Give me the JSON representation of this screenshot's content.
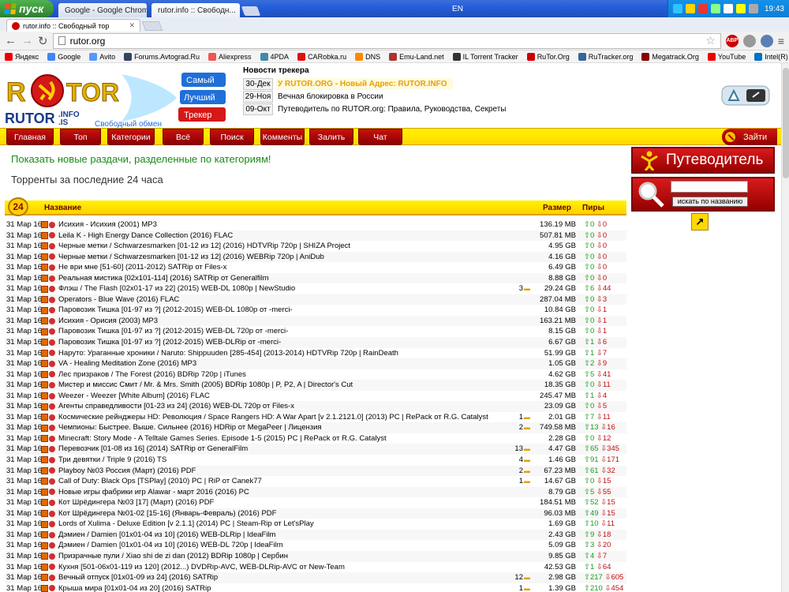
{
  "taskbar": {
    "start": "пуск",
    "tabs": [
      {
        "title": "Google - Google Chrome"
      },
      {
        "title": "rutor.info :: Свободн..."
      }
    ],
    "lang": "EN",
    "time": "19:43"
  },
  "browser": {
    "tab_title": "rutor.info :: Свободный тор",
    "url": "rutor.org",
    "bookmarks": [
      "Яндекс",
      "Google",
      "Avito",
      "Forums.Avtograd.Ru",
      "Aliexpress",
      "4PDA",
      "CARobka.ru",
      "DNS",
      "Emu-Land.net",
      "IL Torrent Tracker",
      "RuTor.Org",
      "RuTracker.org",
      "Megatrack.Org",
      "YouTube",
      "Intel(R) Retail Edge"
    ]
  },
  "site": {
    "logo_words": [
      "Самый",
      "Лучший",
      "Трекер"
    ],
    "logo_sub": "Свободный обмен",
    "news_title": "Новости трекера",
    "news": [
      {
        "date": "30-Дек",
        "text": "У RUTOR.ORG - Новый Адрес: RUTOR.INFO"
      },
      {
        "date": "29-Ноя",
        "text": "Вечная блокировка в России"
      },
      {
        "date": "09-Окт",
        "text": "Путеводитель по RUTOR.org: Правила, Руководства, Секреты"
      }
    ],
    "menu": [
      "Главная",
      "Топ",
      "Категории",
      "Всё",
      "Поиск",
      "Комменты",
      "Залить",
      "Чат"
    ],
    "enter": "Зайти",
    "show_categories": "Показать новые раздачи, разделенные по категориям!",
    "last24": "Торренты за последние 24 часа",
    "badge": "24",
    "col_name": "Название",
    "col_size": "Размер",
    "col_peers": "Пиры",
    "guide": "Путеводитель",
    "search_button": "искать по названию"
  },
  "rows": [
    {
      "date": "31 Мар 16",
      "name": "Исихия - Исихия (2001) MP3",
      "com": "",
      "size": "136.19 MB",
      "up": "0",
      "dn": "0"
    },
    {
      "date": "31 Мар 16",
      "name": "Leila K - High Energy Dance Collection (2016) FLAC",
      "com": "",
      "size": "507.81 MB",
      "up": "0",
      "dn": "0"
    },
    {
      "date": "31 Мар 16",
      "name": "Черные метки / Schwarzesmarken [01-12 из 12] (2016) HDTVRip 720p | SHIZA Project",
      "com": "",
      "size": "4.95 GB",
      "up": "0",
      "dn": "0"
    },
    {
      "date": "31 Мар 16",
      "name": "Черные метки / Schwarzesmarken [01-12 из 12] (2016) WEBRip 720p | AniDub",
      "com": "",
      "size": "4.16 GB",
      "up": "0",
      "dn": "0"
    },
    {
      "date": "31 Мар 16",
      "name": "Не ври мне [51-60] (2011-2012) SATRip от Files-x",
      "com": "",
      "size": "6.49 GB",
      "up": "0",
      "dn": "0"
    },
    {
      "date": "31 Мар 16",
      "name": "Реальная мистика [02x101-114] (2016) SATRip от Generalfilm",
      "com": "",
      "size": "8.88 GB",
      "up": "0",
      "dn": "0"
    },
    {
      "date": "31 Мар 16",
      "name": "Флэш / The Flash [02x01-17 из 22] (2015) WEB-DL 1080p | NewStudio",
      "com": "3",
      "size": "29.24 GB",
      "up": "6",
      "dn": "44"
    },
    {
      "date": "31 Мар 16",
      "name": "Operators - Blue Wave (2016) FLAC",
      "com": "",
      "size": "287.04 MB",
      "up": "0",
      "dn": "3"
    },
    {
      "date": "31 Мар 16",
      "name": "Паровозик Тишка [01-97 из ?] (2012-2015) WEB-DL 1080p от -merci-",
      "com": "",
      "size": "10.84 GB",
      "up": "0",
      "dn": "1"
    },
    {
      "date": "31 Мар 16",
      "name": "Исихия - Орисия (2003) MP3",
      "com": "",
      "size": "163.21 MB",
      "up": "0",
      "dn": "1"
    },
    {
      "date": "31 Мар 16",
      "name": "Паровозик Тишка [01-97 из ?] (2012-2015) WEB-DL 720p от -merci-",
      "com": "",
      "size": "8.15 GB",
      "up": "0",
      "dn": "1"
    },
    {
      "date": "31 Мар 16",
      "name": "Паровозик Тишка [01-97 из ?] (2012-2015) WEB-DLRip от -merci-",
      "com": "",
      "size": "6.67 GB",
      "up": "1",
      "dn": "6"
    },
    {
      "date": "31 Мар 16",
      "name": "Наруто: Ураганные хроники / Naruto: Shippuuden [285-454] (2013-2014) HDTVRip 720p | RainDeath",
      "com": "",
      "size": "51.99 GB",
      "up": "1",
      "dn": "7"
    },
    {
      "date": "31 Мар 16",
      "name": "VA - Healing Meditation Zone (2016) MP3",
      "com": "",
      "size": "1.05 GB",
      "up": "2",
      "dn": "9"
    },
    {
      "date": "31 Мар 16",
      "name": "Лес призраков / The Forest (2016) BDRip 720p | iTunes",
      "com": "",
      "size": "4.62 GB",
      "up": "5",
      "dn": "41"
    },
    {
      "date": "31 Мар 16",
      "name": "Мистер и миссис Смит / Mr. & Mrs. Smith (2005) BDRip 1080p | P, P2, A | Director's Cut",
      "com": "",
      "size": "18.35 GB",
      "up": "0",
      "dn": "11"
    },
    {
      "date": "31 Мар 16",
      "name": "Weezer - Weezer [White Album] (2016) FLAC",
      "com": "",
      "size": "245.47 MB",
      "up": "1",
      "dn": "4"
    },
    {
      "date": "31 Мар 16",
      "name": "Агенты справедливости [01-23 из 24] (2016) WEB-DL 720p от Files-x",
      "com": "",
      "size": "23.09 GB",
      "up": "0",
      "dn": "5"
    },
    {
      "date": "31 Мар 16",
      "name": "Космические рейнджеры HD: Революция / Space Rangers HD: A War Apart [v 2.1.2121.0] (2013) PC | RePack от R.G. Catalyst",
      "com": "1",
      "size": "2.01 GB",
      "up": "7",
      "dn": "11"
    },
    {
      "date": "31 Мар 16",
      "name": "Чемпионы: Быстрее. Выше. Сильнее (2016) HDRip от MegaPeer | Лицензия",
      "com": "2",
      "size": "749.58 MB",
      "up": "13",
      "dn": "16"
    },
    {
      "date": "31 Мар 16",
      "name": "Minecraft: Story Mode - A Telltale Games Series. Episode 1-5 (2015) PC | RePack от R.G. Catalyst",
      "com": "",
      "size": "2.28 GB",
      "up": "0",
      "dn": "12"
    },
    {
      "date": "31 Мар 16",
      "name": "Перевозчик [01-08 из 16] (2014) SATRip от GeneralFilm",
      "com": "13",
      "size": "4.47 GB",
      "up": "65",
      "dn": "345"
    },
    {
      "date": "31 Мар 16",
      "name": "Три девятки / Triple 9 (2016) TS",
      "com": "4",
      "size": "1.46 GB",
      "up": "91",
      "dn": "171"
    },
    {
      "date": "31 Мар 16",
      "name": "Playboy №03 Россия (Март) (2016) PDF",
      "com": "2",
      "size": "67.23 MB",
      "up": "61",
      "dn": "32"
    },
    {
      "date": "31 Мар 16",
      "name": "Call of Duty: Black Ops [TSPlay] (2010) PC | RiP от Canek77",
      "com": "1",
      "size": "14.67 GB",
      "up": "0",
      "dn": "15"
    },
    {
      "date": "31 Мар 16",
      "name": "Новые игры фабрики игр Alawar - март 2016 (2016) PC",
      "com": "",
      "size": "8.79 GB",
      "up": "5",
      "dn": "55"
    },
    {
      "date": "31 Мар 16",
      "name": "Кот Шрёдингера №03 [17] (Март) (2016) PDF",
      "com": "",
      "size": "184.51 MB",
      "up": "52",
      "dn": "15"
    },
    {
      "date": "31 Мар 16",
      "name": "Кот Шрёдингера №01-02 [15-16] (Январь-Февраль) (2016) PDF",
      "com": "",
      "size": "96.03 MB",
      "up": "49",
      "dn": "15"
    },
    {
      "date": "31 Мар 16",
      "name": "Lords of Xulima - Deluxe Edition [v 2.1.1] (2014) PC | Steam-Rip от Let'sPlay",
      "com": "",
      "size": "1.69 GB",
      "up": "10",
      "dn": "11"
    },
    {
      "date": "31 Мар 16",
      "name": "Дэмиен / Damien [01x01-04 из 10] (2016) WEB-DLRip | IdeaFilm",
      "com": "",
      "size": "2.43 GB",
      "up": "9",
      "dn": "18"
    },
    {
      "date": "31 Мар 16",
      "name": "Дэмиен / Damien [01x01-04 из 10] (2016) WEB-DL 720p | IdeaFilm",
      "com": "",
      "size": "5.09 GB",
      "up": "3",
      "dn": "20"
    },
    {
      "date": "31 Мар 16",
      "name": "Призрачные пули / Xiao shi de zi dan (2012) BDRip 1080p | Сербин",
      "com": "",
      "size": "9.85 GB",
      "up": "4",
      "dn": "7"
    },
    {
      "date": "31 Мар 16",
      "name": "Кухня [501-06x01-119 из 120] (2012...) DVDRip-AVC, WEB-DLRip-AVC от New-Team",
      "com": "",
      "size": "42.53 GB",
      "up": "1",
      "dn": "64"
    },
    {
      "date": "31 Мар 16",
      "name": "Вечный отпуск [01x01-09 из 24] (2016) SATRip",
      "com": "12",
      "size": "2.98 GB",
      "up": "217",
      "dn": "605"
    },
    {
      "date": "31 Мар 16",
      "name": "Крыша мира [01x01-04 из 20] (2016) SATRip",
      "com": "1",
      "size": "1.39 GB",
      "up": "210",
      "dn": "454"
    }
  ]
}
